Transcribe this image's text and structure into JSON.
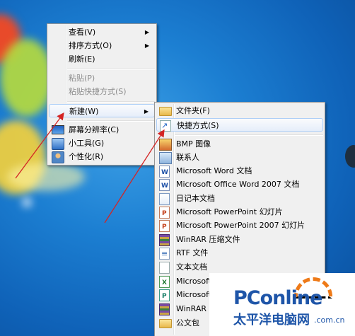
{
  "desktop_menu": {
    "items": [
      {
        "label": "查看(V)",
        "submenu": true,
        "disabled": false
      },
      {
        "label": "排序方式(O)",
        "submenu": true,
        "disabled": false
      },
      {
        "label": "刷新(E)",
        "submenu": false,
        "disabled": false
      },
      {
        "label": "粘贴(P)",
        "submenu": false,
        "disabled": true
      },
      {
        "label": "粘贴快捷方式(S)",
        "submenu": false,
        "disabled": true
      },
      {
        "label": "新建(W)",
        "submenu": true,
        "disabled": false,
        "active": true
      },
      {
        "label": "屏幕分辨率(C)",
        "submenu": false,
        "disabled": false,
        "icon": "screen-icon"
      },
      {
        "label": "小工具(G)",
        "submenu": false,
        "disabled": false,
        "icon": "gadget-icon"
      },
      {
        "label": "个性化(R)",
        "submenu": false,
        "disabled": false,
        "icon": "personalize-icon"
      }
    ]
  },
  "new_submenu": {
    "items": [
      {
        "label": "文件夹(F)",
        "icon": "folder-icon"
      },
      {
        "label": "快捷方式(S)",
        "icon": "shortcut-icon",
        "active": true
      },
      {
        "label": "BMP 图像",
        "icon": "bmp-image-icon"
      },
      {
        "label": "联系人",
        "icon": "contact-icon"
      },
      {
        "label": "Microsoft Word 文档",
        "icon": "word-doc-icon"
      },
      {
        "label": "Microsoft Office Word 2007 文档",
        "icon": "word-doc-icon"
      },
      {
        "label": "日记本文档",
        "icon": "journal-icon"
      },
      {
        "label": "Microsoft PowerPoint 幻灯片",
        "icon": "powerpoint-icon"
      },
      {
        "label": "Microsoft PowerPoint 2007 幻灯片",
        "icon": "powerpoint-icon"
      },
      {
        "label": "WinRAR 压缩文件",
        "icon": "winrar-icon"
      },
      {
        "label": "RTF 文件",
        "icon": "rtf-icon"
      },
      {
        "label": "文本文档",
        "icon": "text-doc-icon"
      },
      {
        "label": "Microsoft",
        "icon": "excel-icon"
      },
      {
        "label": "Microsoft",
        "icon": "publisher-icon"
      },
      {
        "label": "WinRAR ZI",
        "icon": "winrar-icon"
      },
      {
        "label": "公文包",
        "icon": "briefcase-icon"
      }
    ]
  },
  "watermark": {
    "brand": "PConline",
    "brand_cn": "太平洋电脑网",
    "domain": ".com.cn"
  },
  "colors": {
    "desktop": "#1c7fd2",
    "menu_bg": "#f0f0f0",
    "highlight_border": "#aecff7",
    "annotation_arrow": "#d42424",
    "watermark_blue": "#1e55a8",
    "watermark_orange": "#ee7a18"
  }
}
